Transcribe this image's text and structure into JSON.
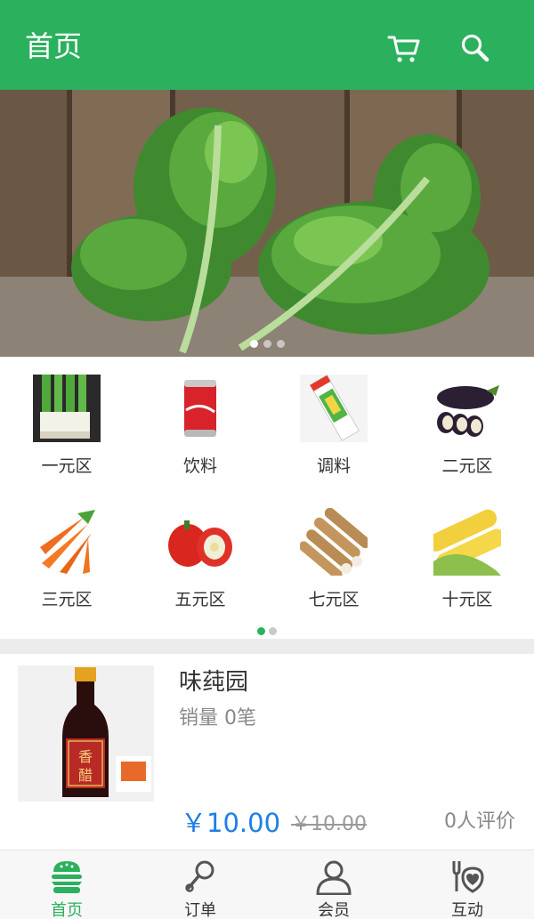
{
  "header": {
    "title": "首页",
    "cart_icon": "cart-icon",
    "search_icon": "search-icon",
    "brand_color": "#2bb05d"
  },
  "banner": {
    "image": "kale-vegetable-photo",
    "active_slide": 1,
    "slide_count": 3
  },
  "categories": {
    "page": 1,
    "page_count": 2,
    "items": [
      {
        "label": "一元区",
        "image": "green-onion"
      },
      {
        "label": "饮料",
        "image": "cola-can"
      },
      {
        "label": "调料",
        "image": "seasoning-box"
      },
      {
        "label": "二元区",
        "image": "eggplant"
      },
      {
        "label": "三元区",
        "image": "carrots"
      },
      {
        "label": "五元区",
        "image": "red-pepper"
      },
      {
        "label": "七元区",
        "image": "yam"
      },
      {
        "label": "十元区",
        "image": "corn"
      }
    ]
  },
  "product": {
    "name": "味莼园",
    "sales": "销量 0笔",
    "price": "￥10.00",
    "original_price": "￥10.00",
    "reviews": "0人评价",
    "image": "vinegar-bottle",
    "bottle_label": "香醋",
    "price_color": "#1e7ee6"
  },
  "bottom_nav": {
    "items": [
      {
        "label": "首页",
        "icon": "home-burger-icon",
        "active": true
      },
      {
        "label": "订单",
        "icon": "order-icon",
        "active": false
      },
      {
        "label": "会员",
        "icon": "member-icon",
        "active": false
      },
      {
        "label": "互动",
        "icon": "interaction-icon",
        "active": false
      }
    ]
  }
}
